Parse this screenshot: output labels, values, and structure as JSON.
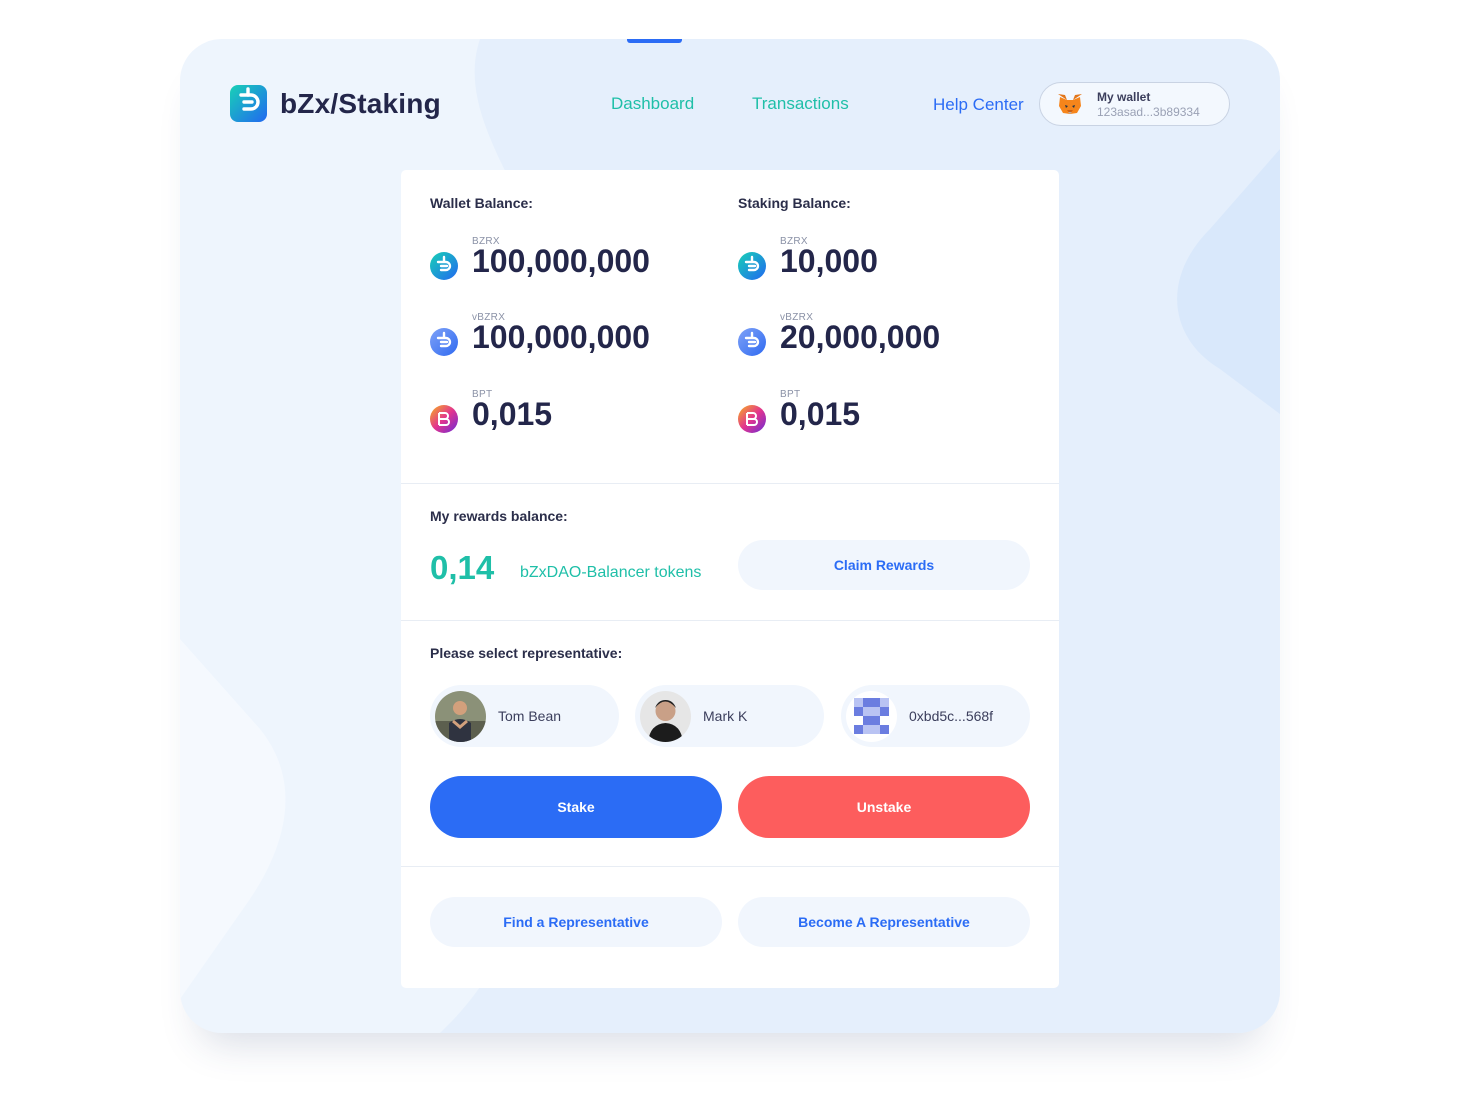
{
  "header": {
    "logo_text": "bZx/Staking",
    "nav": {
      "dashboard": "Dashboard",
      "transactions": "Transactions",
      "help_center": "Help Center"
    },
    "wallet": {
      "label": "My wallet",
      "address": "123asad...3b89334",
      "icon": "metamask-fox-icon"
    }
  },
  "wallet_balance": {
    "title": "Wallet Balance:",
    "tokens": [
      {
        "name": "BZRX",
        "value": "100,000,000",
        "icon": "bzrx-icon"
      },
      {
        "name": "vBZRX",
        "value": "100,000,000",
        "icon": "vbzrx-icon"
      },
      {
        "name": "BPT",
        "value": "0,015",
        "icon": "bpt-icon"
      }
    ]
  },
  "staking_balance": {
    "title": "Staking Balance:",
    "tokens": [
      {
        "name": "BZRX",
        "value": "10,000",
        "icon": "bzrx-icon"
      },
      {
        "name": "vBZRX",
        "value": "20,000,000",
        "icon": "vbzrx-icon"
      },
      {
        "name": "BPT",
        "value": "0,015",
        "icon": "bpt-icon"
      }
    ]
  },
  "rewards": {
    "title": "My rewards balance:",
    "value": "0,14",
    "unit": "bZxDAO-Balancer tokens",
    "claim_label": "Claim Rewards"
  },
  "representatives": {
    "title": "Please select representative:",
    "items": [
      {
        "name": "Tom Bean"
      },
      {
        "name": "Mark K"
      },
      {
        "name": "0xbd5c...568f"
      }
    ]
  },
  "actions": {
    "stake_label": "Stake",
    "unstake_label": "Unstake",
    "find_label": "Find a Representative",
    "become_label": "Become A Representative"
  },
  "colors": {
    "accent_blue": "#2b6cf5",
    "accent_teal": "#1fbfa8",
    "danger_red": "#fd5d5d",
    "frame_bg": "#eef5fd"
  }
}
